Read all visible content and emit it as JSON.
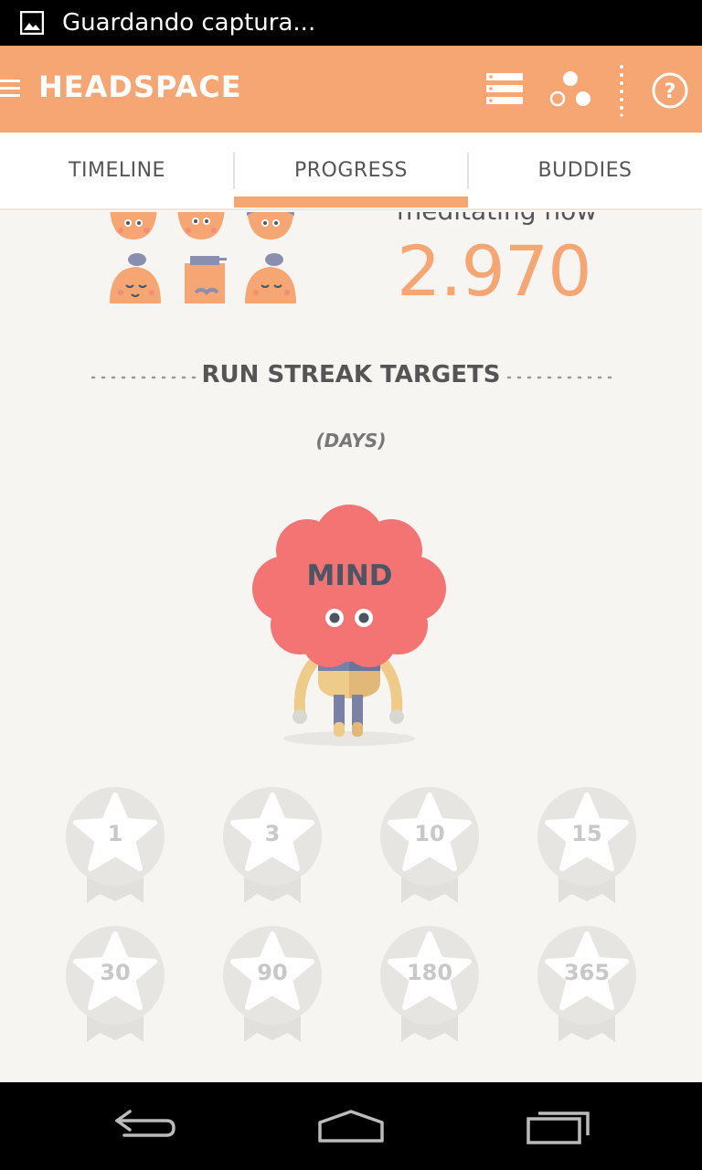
{
  "status_bar": {
    "notification_text": "Guardando captura..."
  },
  "app_bar": {
    "title": "HEADSPACE"
  },
  "tabs": [
    {
      "label": "TIMELINE",
      "selected": false
    },
    {
      "label": "PROGRESS",
      "selected": true
    },
    {
      "label": "BUDDIES",
      "selected": false
    }
  ],
  "meditating": {
    "label": "meditating now",
    "count": "2.970"
  },
  "run_streak": {
    "title": "RUN STREAK TARGETS",
    "subtitle": "(DAYS)",
    "character_label": "MIND",
    "targets": [
      "1",
      "3",
      "10",
      "15",
      "30",
      "90",
      "180",
      "365"
    ]
  },
  "colors": {
    "accent": "#f5a672",
    "mind_head": "#f47474",
    "badge": "#e7e5e2",
    "background": "#f7f5f2"
  }
}
